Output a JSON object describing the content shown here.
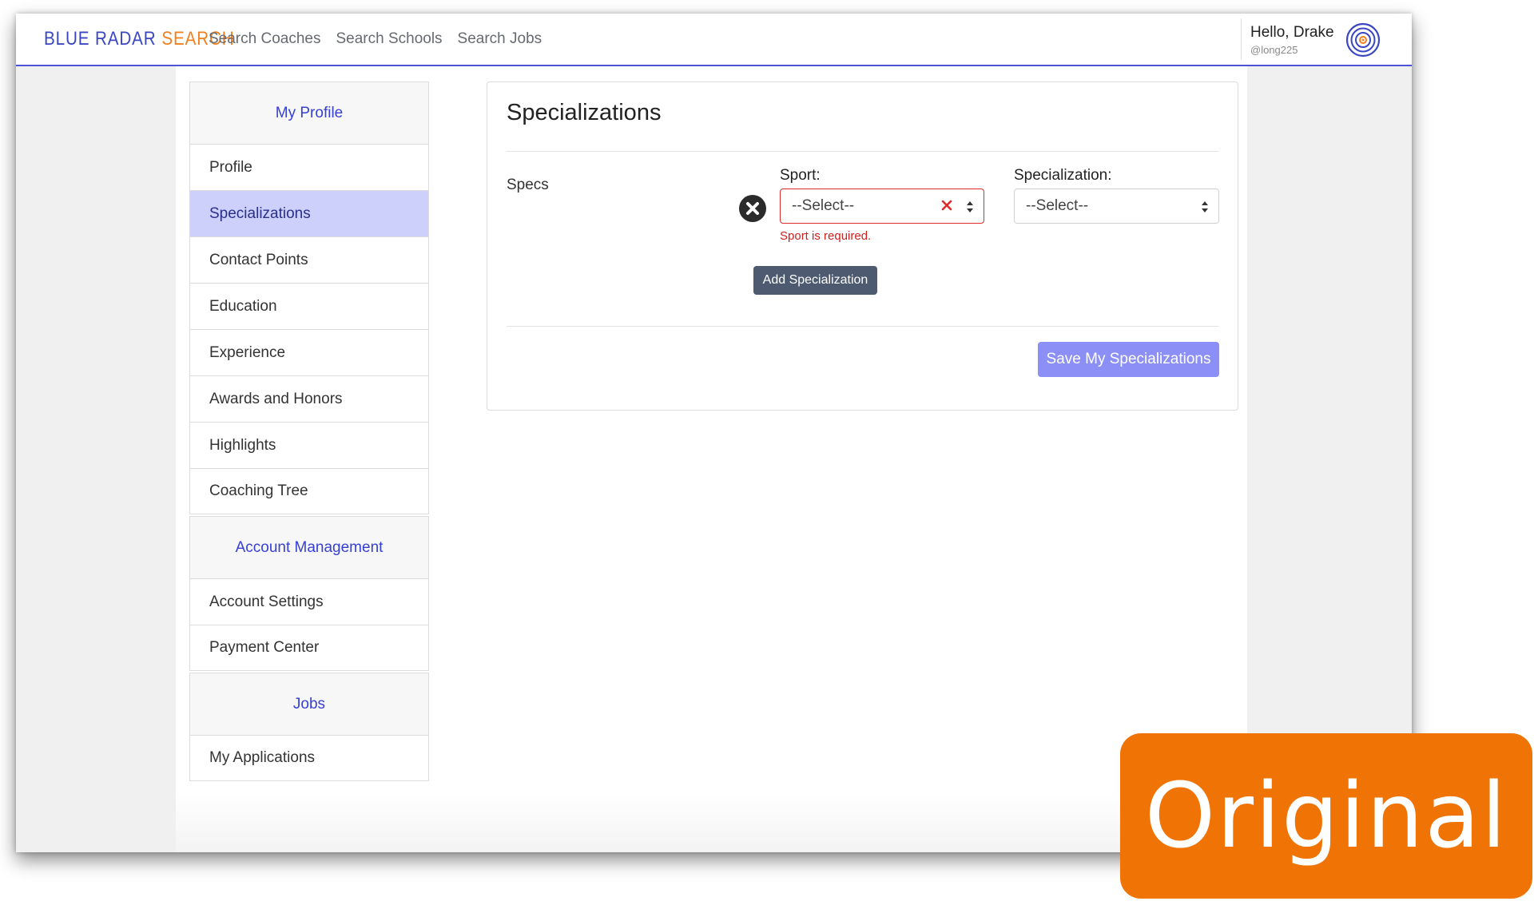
{
  "brand": {
    "part1": "BLUE RADAR",
    "part2": "SEARCH"
  },
  "nav": {
    "links": [
      "Search Coaches",
      "Search Schools",
      "Search Jobs"
    ]
  },
  "user": {
    "greeting": "Hello, Drake",
    "handle": "@long225",
    "avatar_icon": "radar-target-icon"
  },
  "sidebar": {
    "groups": [
      {
        "title": "My Profile",
        "items": [
          "Profile",
          "Specializations",
          "Contact Points",
          "Education",
          "Experience",
          "Awards and Honors",
          "Highlights",
          "Coaching Tree"
        ]
      },
      {
        "title": "Account Management",
        "items": [
          "Account Settings",
          "Payment Center"
        ]
      },
      {
        "title": "Jobs",
        "items": [
          "My Applications"
        ]
      }
    ],
    "active_item": "Specializations"
  },
  "main": {
    "title": "Specializations",
    "specs_label": "Specs",
    "sport_label": "Sport:",
    "sport_value": "--Select--",
    "sport_error": "Sport is required.",
    "specialization_label": "Specialization:",
    "specialization_value": "--Select--",
    "add_button": "Add Specialization",
    "save_button": "Save My Specializations"
  },
  "badge": {
    "text": "Original"
  },
  "colors": {
    "accent": "#3b46c4",
    "brand_orange": "#f0801f",
    "error": "#e02b2b",
    "active_bg": "#ccd0fb",
    "save_button": "#8c8ff5",
    "badge": "#ef7305"
  }
}
